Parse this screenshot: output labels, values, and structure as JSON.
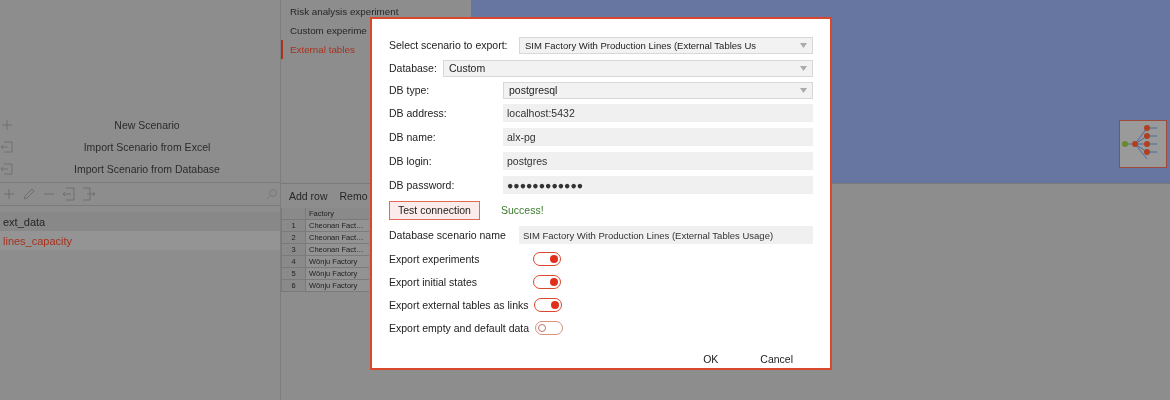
{
  "left_panel": {
    "actions": [
      {
        "label": "New Scenario",
        "kind": "new"
      },
      {
        "label": "Import Scenario from Excel",
        "kind": "import"
      },
      {
        "label": "Import Scenario from Database",
        "kind": "import"
      }
    ],
    "tables": [
      {
        "label": "ext_data",
        "selected": false
      },
      {
        "label": "lines_capacity",
        "selected": true
      }
    ]
  },
  "experiments": [
    {
      "label": "Risk analysis experiment",
      "selected": false
    },
    {
      "label": "Custom experime",
      "selected": false
    },
    {
      "label": "External tables",
      "selected": true
    }
  ],
  "table_toolbar": [
    "Add row",
    "Remo"
  ],
  "table": {
    "columns": [
      "Factory"
    ],
    "rows": [
      {
        "index": "1",
        "factory": "Cheonan Fact…"
      },
      {
        "index": "2",
        "factory": "Cheonan Fact…"
      },
      {
        "index": "3",
        "factory": "Cheonan Fact…"
      },
      {
        "index": "4",
        "factory": "Wŏnju Factory"
      },
      {
        "index": "5",
        "factory": "Wŏnju Factory"
      },
      {
        "index": "6",
        "factory": "Wŏnju Factory"
      }
    ]
  },
  "dialog": {
    "scenario_select": {
      "label": "Select scenario to export:",
      "value": "SIM Factory With Production Lines (External Tables Us"
    },
    "database_select": {
      "label": "Database:",
      "value": "Custom"
    },
    "connection_fields": [
      {
        "label": "DB type:",
        "kind": "select",
        "value": "postgresql"
      },
      {
        "label": "DB address:",
        "kind": "input",
        "value": "localhost:5432"
      },
      {
        "label": "DB name:",
        "kind": "input",
        "value": "alx-pg"
      },
      {
        "label": "DB login:",
        "kind": "input",
        "value": "postgres"
      },
      {
        "label": "DB password:",
        "kind": "input",
        "value": "●●●●●●●●●●●●"
      }
    ],
    "test_button": "Test connection",
    "status": "Success!",
    "scenario_name": {
      "label": "Database scenario name",
      "value": "SIM Factory With Production Lines (External Tables Usage)"
    },
    "options": [
      {
        "label": "Export experiments",
        "on": true
      },
      {
        "label": "Export initial states",
        "on": true
      },
      {
        "label": "Export external tables as links",
        "on": true
      },
      {
        "label": "Export empty and default data",
        "on": false
      }
    ],
    "buttons": [
      "OK",
      "Cancel"
    ]
  }
}
